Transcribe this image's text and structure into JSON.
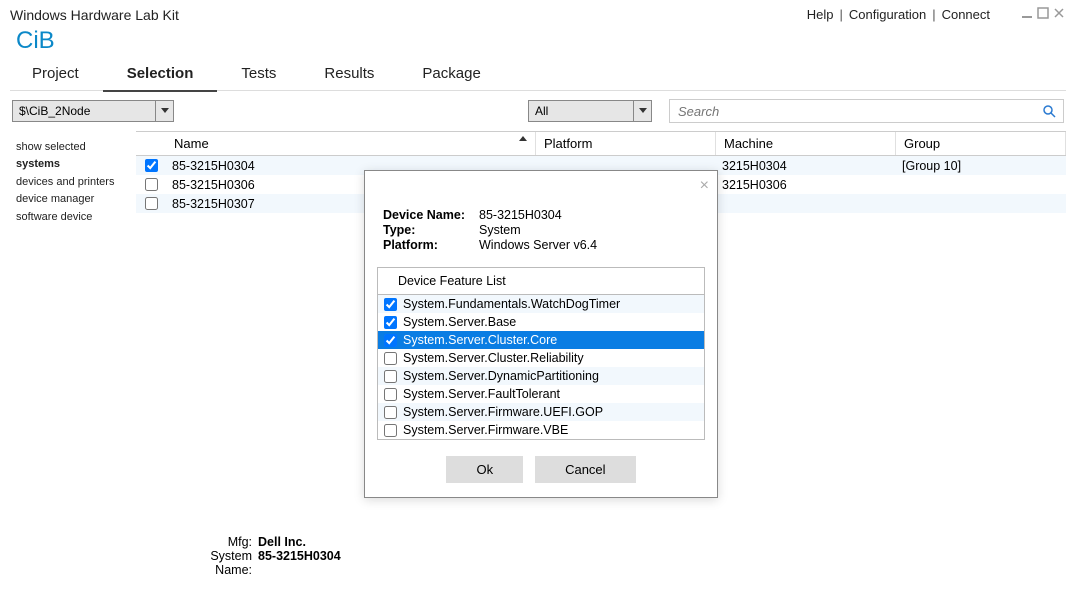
{
  "titlebar": {
    "title": "Windows Hardware Lab Kit",
    "menus": [
      "Help",
      "Configuration",
      "Connect"
    ]
  },
  "subtitle": "CiB",
  "tabs": [
    {
      "label": "Project",
      "active": false
    },
    {
      "label": "Selection",
      "active": true
    },
    {
      "label": "Tests",
      "active": false
    },
    {
      "label": "Results",
      "active": false
    },
    {
      "label": "Package",
      "active": false
    }
  ],
  "toolbar": {
    "pool_select": "$\\CiB_2Node",
    "filter_select": "All",
    "search_placeholder": "Search"
  },
  "sidebar": {
    "items": [
      {
        "label": "show selected",
        "bold": false
      },
      {
        "label": "systems",
        "bold": true
      },
      {
        "label": "devices and printers",
        "bold": false
      },
      {
        "label": "device manager",
        "bold": false
      },
      {
        "label": "software device",
        "bold": false
      }
    ]
  },
  "grid": {
    "columns": [
      "Name",
      "Platform",
      "Machine",
      "Group"
    ],
    "sort_col": "Name",
    "rows": [
      {
        "checked": true,
        "name": "85-3215H0304",
        "platform": "",
        "machine": "3215H0304",
        "group": "[Group 10]"
      },
      {
        "checked": false,
        "name": "85-3215H0306",
        "platform": "",
        "machine": "3215H0306",
        "group": ""
      },
      {
        "checked": false,
        "name": "85-3215H0307",
        "platform": "",
        "machine": "",
        "group": ""
      }
    ]
  },
  "dialog": {
    "labels": {
      "device_name": "Device Name:",
      "type": "Type:",
      "platform": "Platform:",
      "feature_header": "Device Feature List"
    },
    "device_name": "85-3215H0304",
    "type": "System",
    "platform": "Windows Server v6.4",
    "features": [
      {
        "label": "System.Fundamentals.WatchDogTimer",
        "checked": true,
        "selected": false
      },
      {
        "label": "System.Server.Base",
        "checked": true,
        "selected": false
      },
      {
        "label": "System.Server.Cluster.Core",
        "checked": true,
        "selected": true
      },
      {
        "label": "System.Server.Cluster.Reliability",
        "checked": false,
        "selected": false
      },
      {
        "label": "System.Server.DynamicPartitioning",
        "checked": false,
        "selected": false
      },
      {
        "label": "System.Server.FaultTolerant",
        "checked": false,
        "selected": false
      },
      {
        "label": "System.Server.Firmware.UEFI.GOP",
        "checked": false,
        "selected": false
      },
      {
        "label": "System.Server.Firmware.VBE",
        "checked": false,
        "selected": false
      }
    ],
    "buttons": {
      "ok": "Ok",
      "cancel": "Cancel"
    }
  },
  "details": {
    "mfg_label": "Mfg:",
    "mfg_value": "Dell Inc.",
    "sysname_label": "System Name:",
    "sysname_value": "85-3215H0304"
  }
}
